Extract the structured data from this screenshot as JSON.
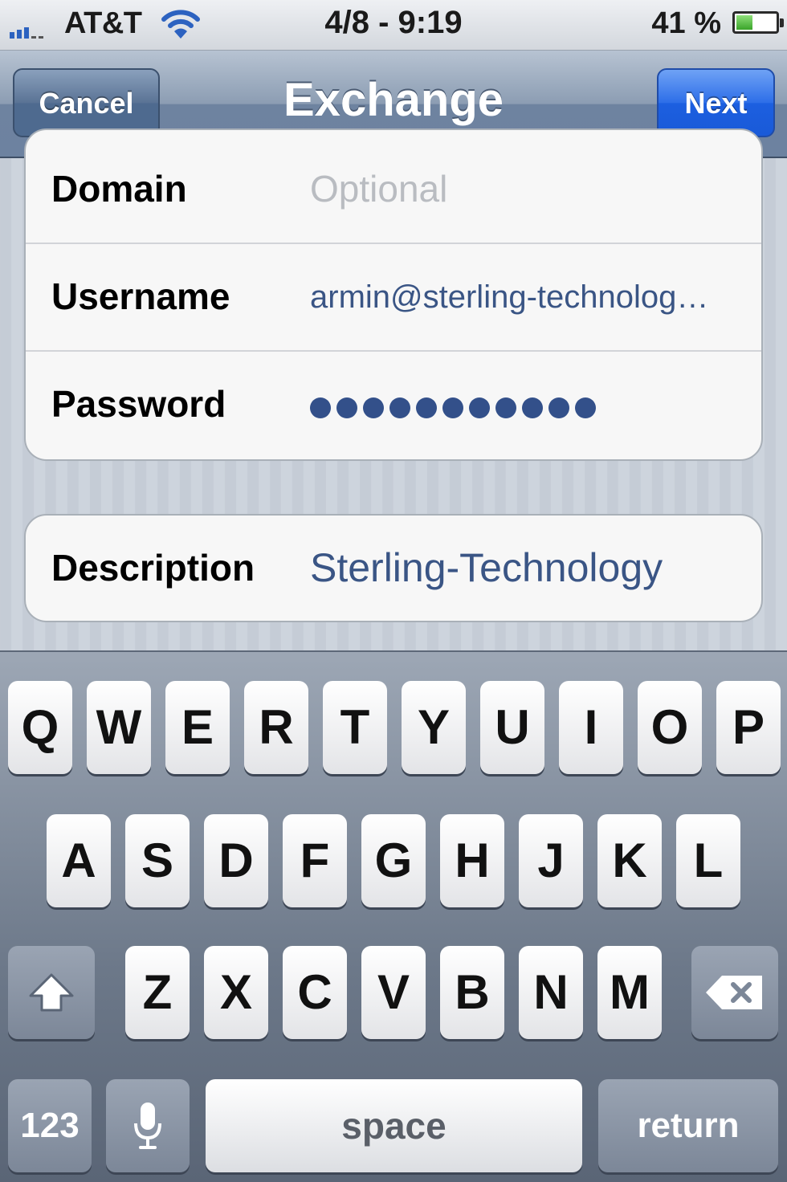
{
  "status_bar": {
    "carrier": "AT&T",
    "time": "4/8 - 9:19",
    "battery_percent": "41 %",
    "battery_level": 0.41,
    "icons": [
      "signal-icon",
      "wifi-icon",
      "battery-icon"
    ]
  },
  "nav_bar": {
    "title": "Exchange",
    "cancel_label": "Cancel",
    "next_label": "Next"
  },
  "form": {
    "domain": {
      "label": "Domain",
      "placeholder": "Optional",
      "value": ""
    },
    "username": {
      "label": "Username",
      "value": "armin@sterling-technolog…"
    },
    "password": {
      "label": "Password",
      "masked_length": 11
    },
    "description": {
      "label": "Description",
      "value": "Sterling-Technology"
    }
  },
  "keyboard": {
    "row1": [
      "Q",
      "W",
      "E",
      "R",
      "T",
      "Y",
      "U",
      "I",
      "O",
      "P"
    ],
    "row2": [
      "A",
      "S",
      "D",
      "F",
      "G",
      "H",
      "J",
      "K",
      "L"
    ],
    "row3": [
      "Z",
      "X",
      "C",
      "V",
      "B",
      "N",
      "M"
    ],
    "numbers_label": "123",
    "space_label": "space",
    "return_label": "return",
    "icons": [
      "shift-icon",
      "backspace-icon",
      "microphone-icon"
    ]
  },
  "colors": {
    "next_button": "#1c5fe0",
    "value_text": "#3a5585",
    "nav_bar": "#6e83a0"
  }
}
